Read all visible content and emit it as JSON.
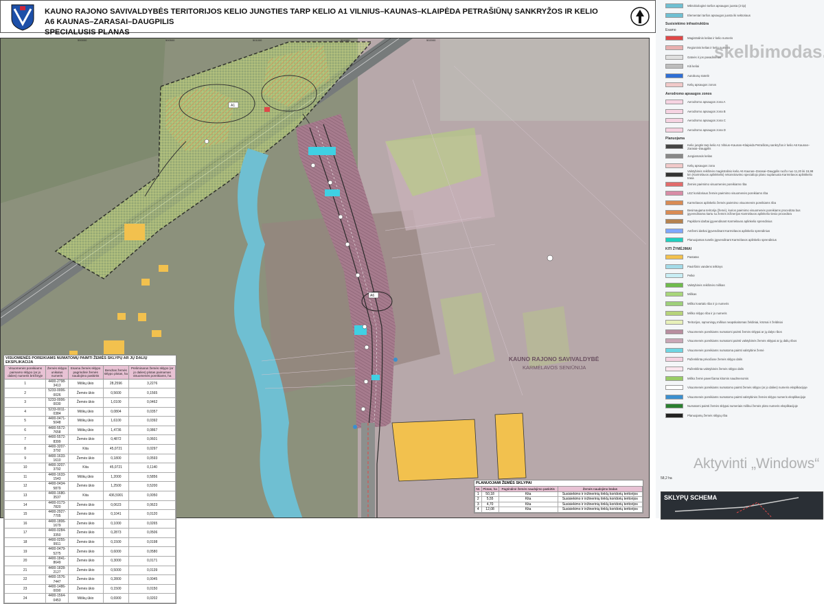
{
  "header": {
    "title_line1": "KAUNO RAJONO SAVIVALDYBĖS TERITORIJOS KELIO JUNGTIES TARP KELIO A1 VILNIUS–KAUNAS–KLAIPĖDA PETRAŠIŪNŲ SANKRYŽOS IR KELIO A6 KAUNAS–ZARASAI–DAUGPILIS",
    "title_line2": "SPECIALUSIS PLANAS",
    "crest_icon": "kaunas-district-coat-of-arms-icon",
    "north_icon": "north-arrow-icon"
  },
  "map": {
    "grid_labels": [
      "500000",
      "500500",
      "501000",
      "501500",
      "502000"
    ],
    "area_label": "KAUNO RAJONO SAVIVALDYBĖ",
    "subarea_label": "KARMĖLAVOS SENIŪNIJA",
    "road_tag_1": "A1",
    "road_tag_2": "A6",
    "colors": {
      "map_bg": "#8b8e7a",
      "pink_area": "#c9a7b7",
      "road_band": "#7c5a6a",
      "river": "#6fbfd2",
      "green_zone": "#b7d47a",
      "yellow_buildings": "#f2c14e",
      "hatch_orange": "#d98b54"
    }
  },
  "table1": {
    "caption": "VISUOMENĖS POREIKIAMS NUMATOMŲ PAIMTI ŽEMĖS SKLYPŲ AR JŲ DALIŲ EKSPLIKACIJA",
    "headers": [
      "Visuomenės poreikiams paimamo sklypo (ar jo dalies) numeris brėžinyje",
      "Žemės sklypo unikalus numeris",
      "Esama žemės sklypo pagrindinė žemės naudojimo paskirtis",
      "Bendras žemės sklypo plotas, ha",
      "Preliminarus žemės sklypo (ar jo dalies) plotas paimamas visuomenės poreikiams, ha"
    ],
    "rows": [
      [
        "1",
        "4400-2798-3413",
        "Miškų ūkio",
        "28,2596",
        "3,2276"
      ],
      [
        "2",
        "5233-0006-0026",
        "Žemės ūkio",
        "0,5600",
        "0,1565"
      ],
      [
        "3",
        "5233-0006-0030",
        "Žemės ūkio",
        "1,0100",
        "0,0462"
      ],
      [
        "4",
        "5233-0011-0384",
        "Miškų ūkio",
        "0,0804",
        "0,0357"
      ],
      [
        "5",
        "4400-0471-5048",
        "Miškų ūkio",
        "1,6100",
        "0,0392"
      ],
      [
        "6",
        "4400-5572-7658",
        "Miškų ūkio",
        "1,4736",
        "0,0867"
      ],
      [
        "7",
        "4400-5572-8399",
        "Žemės ūkio",
        "0,4872",
        "0,0601"
      ],
      [
        "8",
        "4400-3207-3792",
        "Kita",
        "45,0721",
        "0,0297"
      ],
      [
        "9",
        "4400-1633-1610",
        "Žemės ūkio",
        "0,1800",
        "0,0593"
      ],
      [
        "10",
        "4400-3207-3792",
        "Kita",
        "45,0721",
        "0,1140"
      ],
      [
        "11",
        "4400-1633-1543",
        "Miškų ūkio",
        "1,2000",
        "0,5856"
      ],
      [
        "12",
        "4400-0434-5879",
        "Žemės ūkio",
        "1,2500",
        "0,5200"
      ],
      [
        "13",
        "4400-1680-3537",
        "Kita",
        "436,5901",
        "0,0050"
      ],
      [
        "14",
        "4400-0173-7820",
        "Žemės ūkio",
        "0,0623",
        "0,0623"
      ],
      [
        "15",
        "4400-2927-7705",
        "Žemės ūkio",
        "0,1041",
        "0,0120"
      ],
      [
        "16",
        "4400-1806-1679",
        "Žemės ūkio",
        "0,1000",
        "0,0265"
      ],
      [
        "17",
        "4400-0284-3350",
        "Žemės ūkio",
        "0,2873",
        "0,0506"
      ],
      [
        "18",
        "4400-0255-9911",
        "Žemės ūkio",
        "0,1500",
        "0,0198"
      ],
      [
        "19",
        "4400-0479-5275",
        "Žemės ūkio",
        "0,6000",
        "0,0580"
      ],
      [
        "20",
        "4400-1841-8649",
        "Žemės ūkio",
        "0,3000",
        "0,0171"
      ],
      [
        "21",
        "4400-1828-2127",
        "Žemės ūkio",
        "0,5000",
        "0,0139"
      ],
      [
        "22",
        "4400-1576-7447",
        "Žemės ūkio",
        "0,2800",
        "0,0045"
      ],
      [
        "23",
        "4400-1486-0090",
        "Žemės ūkio",
        "0,1500",
        "0,0150"
      ],
      [
        "24",
        "4400-1564-0453",
        "Miškų ūkio",
        "0,6900",
        "0,0202"
      ]
    ]
  },
  "table2": {
    "caption": "PLANUOJAMI ŽEMĖS SKLYPAI",
    "headers": [
      "Nr.",
      "Plotas, ha",
      "Pagrindinė žemės naudojimo paskirtis",
      "Žemės naudojimo būdas"
    ],
    "rows": [
      [
        "1",
        "50,18",
        "Kita",
        "Susisiekimo ir inžinerinių tinklų koridorių teritorijos"
      ],
      [
        "2",
        "5,55",
        "Kita",
        "Susisiekimo ir inžinerinių tinklų koridorių teritorijos"
      ],
      [
        "3",
        "4,70",
        "Kita",
        "Susisiekimo ir inžinerinių tinklų koridorių teritorijos"
      ],
      [
        "4",
        "12,08",
        "Kita",
        "Susisiekimo ir inžinerinių tinklų koridorių teritorijos"
      ]
    ]
  },
  "legend": {
    "top_items": [
      {
        "label": "Mikrobiologinė taršos apsaugos juosta (2 tip)",
        "color": "#6fbfd2"
      },
      {
        "label": "Elementari taršos apsaugos juosta iki sektoriaus",
        "color": "#6fbfd2"
      }
    ],
    "section_1": "Susisiekimo infrastruktūra",
    "section_1_sub": "Esamo",
    "items_1": [
      {
        "label": "Magistralinis kelias ir kelio numeris",
        "color": "#e04848"
      },
      {
        "label": "Regioninis kelias ir kelio numeris",
        "color": "#e9b0b0"
      },
      {
        "label": "Gatvės ir jos pavadinimas",
        "color": "#e0e0e0"
      },
      {
        "label": "Kiti keliai",
        "color": "#bdbdbd"
      },
      {
        "label": "Autobusų stotelė",
        "color": "#2e6fd6"
      },
      {
        "label": "Kelių apsaugos zonos",
        "color": "#f1c9c9"
      }
    ],
    "section_2": "Aerodromo apsaugos zonos",
    "items_2": [
      {
        "label": "Aerodromo apsaugos zona A",
        "color": "#f6d3e2"
      },
      {
        "label": "Aerodromo apsaugos zona B",
        "color": "#f6d3e2"
      },
      {
        "label": "Aerodromo apsaugos zona C",
        "color": "#f6d3e2"
      },
      {
        "label": "Aerodromo apsaugos zona D",
        "color": "#f6d3e2"
      }
    ],
    "section_3": "Planuojama",
    "items_3": [
      {
        "label": "Kelio jungtis tarp kelio A1 Vilnius–Kaunas–Klaipėda Petrašiūnų sankryžos ir kelio A6 Kaunas–Zarasai–Daugpilis",
        "color": "#444444"
      },
      {
        "label": "Jungiamasis kelias",
        "color": "#888888"
      },
      {
        "label": "Kelių apsaugos zona",
        "color": "#f1c9c9"
      },
      {
        "label": "Valstybinės reikšmės magistralinio kelio A6 Kaunas–Zarasai–Daugpilis ruožo nuo 11,20 iki 15,98 km (Karmėlavos aplinkkelis) rekonstravimo specialiojo plano suplanuota Karmėlavos aplinkkelio trasa",
        "color": "#333333"
      },
      {
        "label": "Žemės paėmimo visuomenės poreikiams riba",
        "color": "#e26b6b"
      },
      {
        "label": "LEZ koridoriaus žemės paėmimo visuomenės poreikiams riba",
        "color": "#d88ca6"
      },
      {
        "label": "Karmėlavos aplinkelio žemės paėmimo visuomenės poreikiams riba",
        "color": "#d98b54"
      },
      {
        "label": "Besimaujama teritorija (žemė), kurios paėmimo visuomenės poreikiams procedūra bus įgyvendinama kartu su žemės inžinerijos Karmėlavos aplinkelio tiesio procedūra",
        "color": "#d98b54"
      },
      {
        "label": "Papildomi darbai įgyvendinant Karmėlavos aplinkelio sprendinius",
        "color": "#b5824f"
      },
      {
        "label": "Antžemi darbai įgyvendinant Karmėlavos aplinkelio sprendinius",
        "color": "#7fa7ff"
      },
      {
        "label": "Planuojamas tunelis įgyvendinant Karmėlavos aplinkelio sprendinius",
        "color": "#20d0c0"
      }
    ],
    "section_4": "KITI ŽYMĖJIMAI",
    "items_4": [
      {
        "label": "Pastatas",
        "color": "#f2c14e"
      },
      {
        "label": "Paviršinis vandens telkinys",
        "color": "#a3dbe8"
      },
      {
        "label": "Pelkė",
        "color": "#c8eef5"
      },
      {
        "label": "Valstybinės reikšmės miškas",
        "color": "#6fbb4c"
      },
      {
        "label": "Miškas",
        "color": "#a8d67a"
      },
      {
        "label": "Miško kvartalo riba ir jo numeris",
        "color": "#9ed07a"
      },
      {
        "label": "Miško sklypo riba ir jo numeris",
        "color": "#b7d47a"
      },
      {
        "label": "Teritorijos, sąmoningų miškus neapskaitomas želdiniai, krūmai ir želdiniai",
        "color": "#e7f0b9"
      },
      {
        "label": "Visuomenės poreikiams numatomi paimti žemės sklypai ar jų dalys ribos",
        "color": "#b88ea0"
      },
      {
        "label": "Visuomenės poreikiams numatomi paimti valstybinės žemės sklypai ar jų dalių ribos",
        "color": "#c9a7b7"
      },
      {
        "label": "Visuomenės poreikiams numatoma paimti valstybinė žemė",
        "color": "#6fd6e3"
      },
      {
        "label": "Paženklinta privačiose žemės sklypo dalis",
        "color": "#f6d3e2"
      },
      {
        "label": "Paženklinta valstybinės žemės sklypo dalis",
        "color": "#fbe6ee"
      },
      {
        "label": "Miško žemė paverčiama kitomis naudmenomis",
        "color": "#98cc66"
      },
      {
        "label": "Visuomenės poreikiams numatomo paimti žemės sklypo (ar jo dalies) numeris eksplikacijoje",
        "color": "#ffffff"
      },
      {
        "label": "Visuomenės poreikiams numatomo paimti valstybinės žemės sklypo numeris eksplikacijoje",
        "color": "#3a8fd0"
      },
      {
        "label": "Numatomi paimti žemės sklypai numeriais miškui žemės ploto numeris eksplikacijoje",
        "color": "#2a7f30"
      },
      {
        "label": "Planuojamų žemės sklypų riba",
        "color": "#222222"
      }
    ],
    "scale_text": "58,2 ha",
    "schema_title": "SKLYPŲ SCHEMA",
    "watermark": "skelbimodas.lt",
    "windows_text": "Aktyvinti „Windows“"
  }
}
